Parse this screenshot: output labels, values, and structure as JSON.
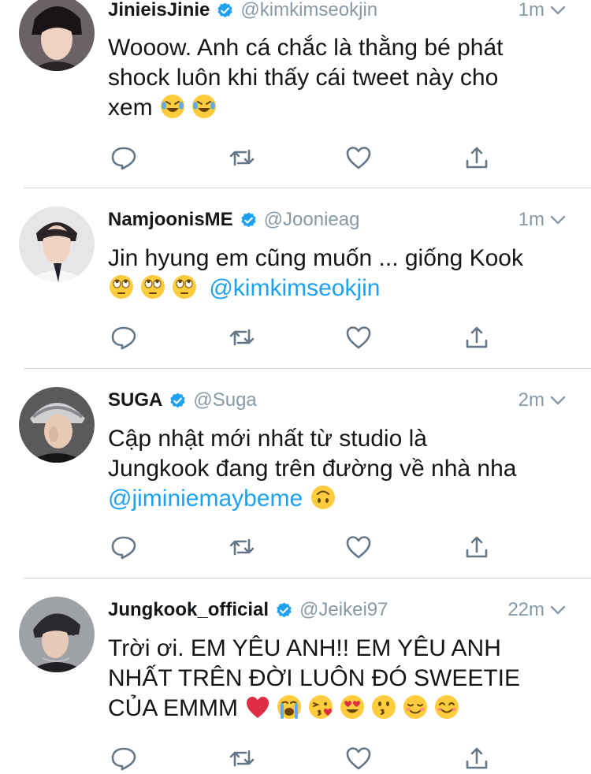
{
  "tweets": [
    {
      "name": "JinieisJinie",
      "handle": "@kimkimseokjin",
      "time": "1m",
      "lines": [
        "Wooow. Anh cá chắc là thằng bé phát",
        "shock luôn khi thấy cái tweet này cho",
        "xem"
      ],
      "emojis": [
        "rofl",
        "rofl"
      ]
    },
    {
      "name": "NamjoonisME",
      "handle": "@Joonieag",
      "time": "1m",
      "lines": [
        "Jin hyung em cũng muốn ... giống Kook"
      ],
      "emojis": [
        "rolling-eyes",
        "rolling-eyes",
        "rolling-eyes"
      ],
      "mention": "@kimkimseokjin"
    },
    {
      "name": "SUGA",
      "handle": "@Suga",
      "time": "2m",
      "lines": [
        "Cập nhật mới nhất từ studio là",
        "Jungkook đang trên đường về nhà nha"
      ],
      "mention": "@jiminiemaybeme",
      "emojis": [
        "upside-down"
      ]
    },
    {
      "name": "Jungkook_official",
      "handle": "@Jeikei97",
      "time": "22m",
      "lines": [
        "Trời ơi. EM YÊU ANH!! EM YÊU ANH",
        "NHẤT TRÊN ĐỜI LUÔN ĐÓ SWEETIE",
        "CỦA EMMM"
      ],
      "emojis": [
        "red-heart",
        "crying",
        "kiss-heart",
        "heart-eyes",
        "kissing",
        "relieved",
        "smiling"
      ]
    }
  ],
  "colors": {
    "accent": "#1da1f2",
    "muted": "#8899a6",
    "icon": "#657786",
    "divider": "#d6dadf"
  }
}
